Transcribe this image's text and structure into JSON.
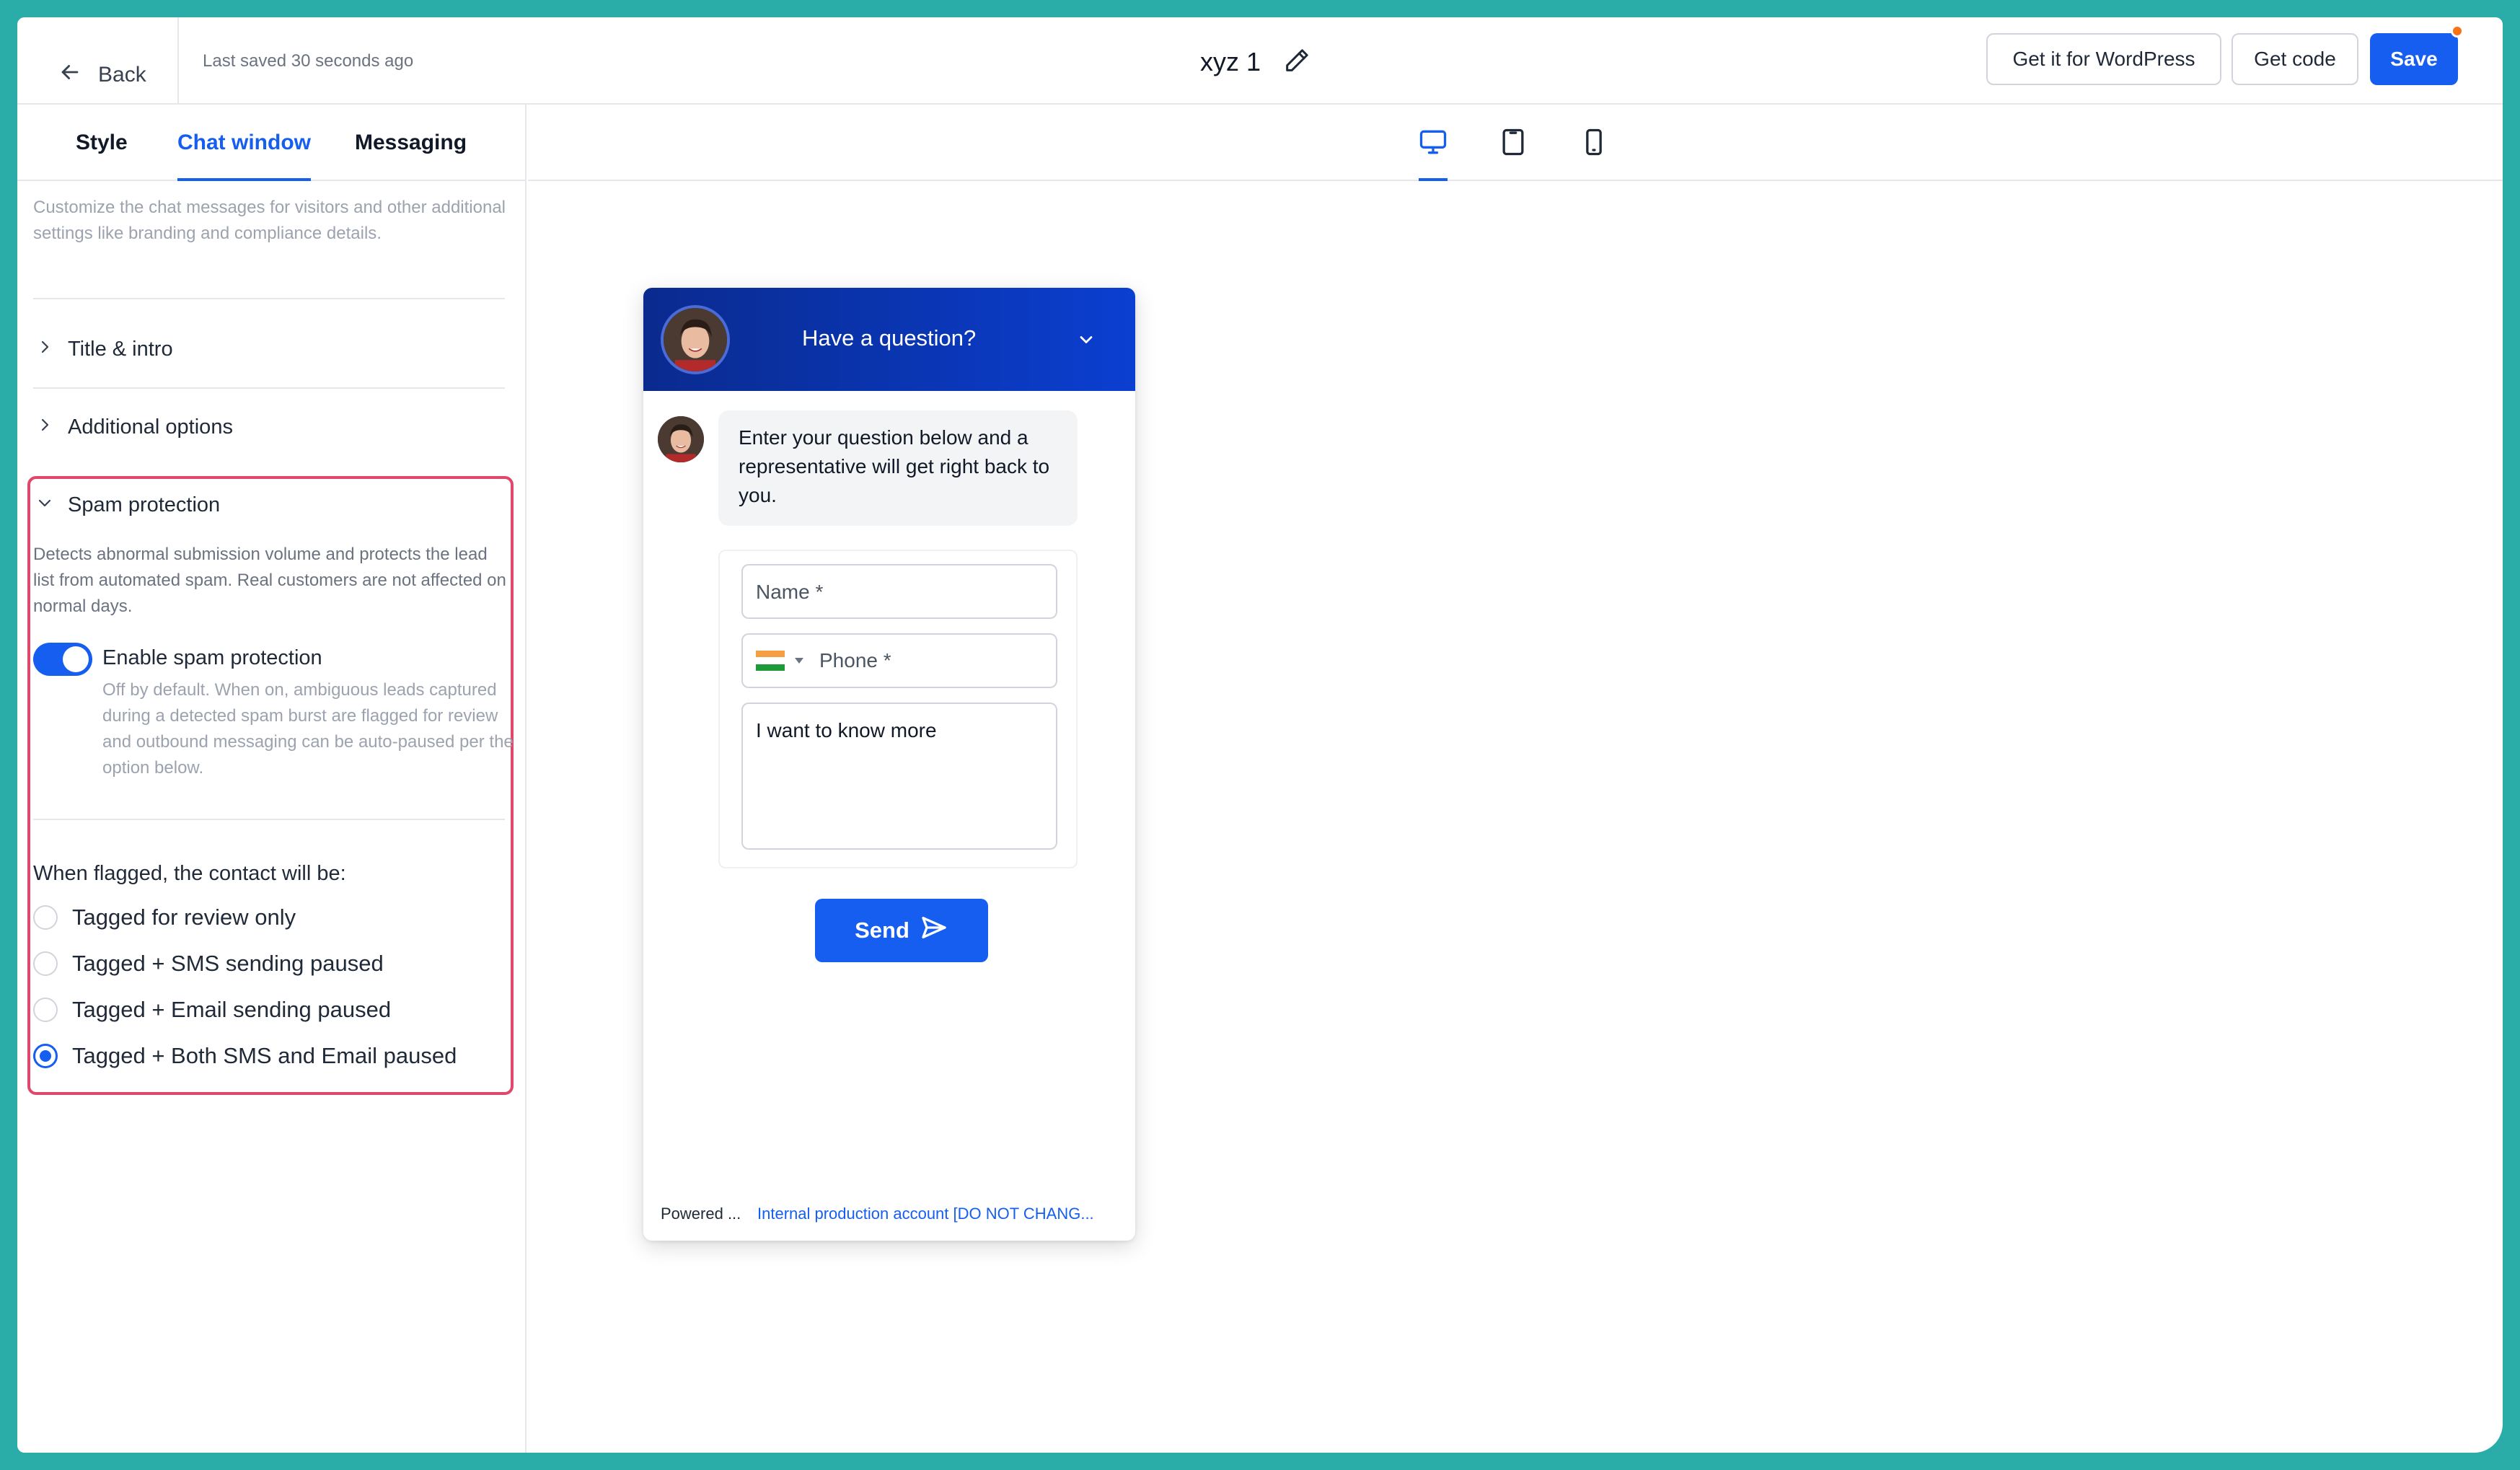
{
  "topbar": {
    "back_label": "Back",
    "last_saved": "Last saved 30 seconds ago",
    "widget_name": "xyz 1",
    "wordpress_label": "Get it for WordPress",
    "get_code_label": "Get code",
    "save_label": "Save"
  },
  "tabs": [
    {
      "label": "Style",
      "active": false
    },
    {
      "label": "Chat window",
      "active": true
    },
    {
      "label": "Messaging",
      "active": false
    }
  ],
  "panel": {
    "description": "Customize the chat messages for visitors and other additional settings like branding and compliance details.",
    "sections": [
      {
        "label": "Title & intro",
        "expanded": false
      },
      {
        "label": "Additional options",
        "expanded": false
      },
      {
        "label": "Spam protection",
        "expanded": true
      }
    ],
    "spam": {
      "description": "Detects abnormal submission volume and protects the lead list from automated spam. Real customers are not affected on normal days.",
      "toggle_label": "Enable spam protection",
      "toggle_on": true,
      "toggle_help": "Off by default. When on, ambiguous leads captured during a detected spam burst are flagged for review and outbound messaging can be auto-paused per the option below.",
      "flag_question": "When flagged, the contact will be:",
      "options": [
        {
          "label": "Tagged for review only",
          "selected": false
        },
        {
          "label": "Tagged + SMS sending paused",
          "selected": false
        },
        {
          "label": "Tagged + Email sending paused",
          "selected": false
        },
        {
          "label": "Tagged + Both SMS and Email paused",
          "selected": true
        }
      ]
    }
  },
  "preview": {
    "device_modes": [
      "desktop-icon",
      "tablet-icon",
      "mobile-icon"
    ],
    "active_device": "desktop",
    "chat": {
      "header_title": "Have a question?",
      "intro_message": "Enter your question below and a representative will get right back to you.",
      "name_placeholder": "Name *",
      "phone_placeholder": "Phone *",
      "message_value": "I want to know more",
      "send_label": "Send",
      "powered_label": "Powered ...",
      "account_link": "Internal production account [DO NOT CHANG..."
    }
  },
  "colors": {
    "accent": "#155eef",
    "highlight_border": "#e0486b",
    "header_gradient_start": "#0a2a8e",
    "header_gradient_end": "#0b3fd1",
    "notification_dot": "#f97316",
    "background": "#2aaca8"
  }
}
